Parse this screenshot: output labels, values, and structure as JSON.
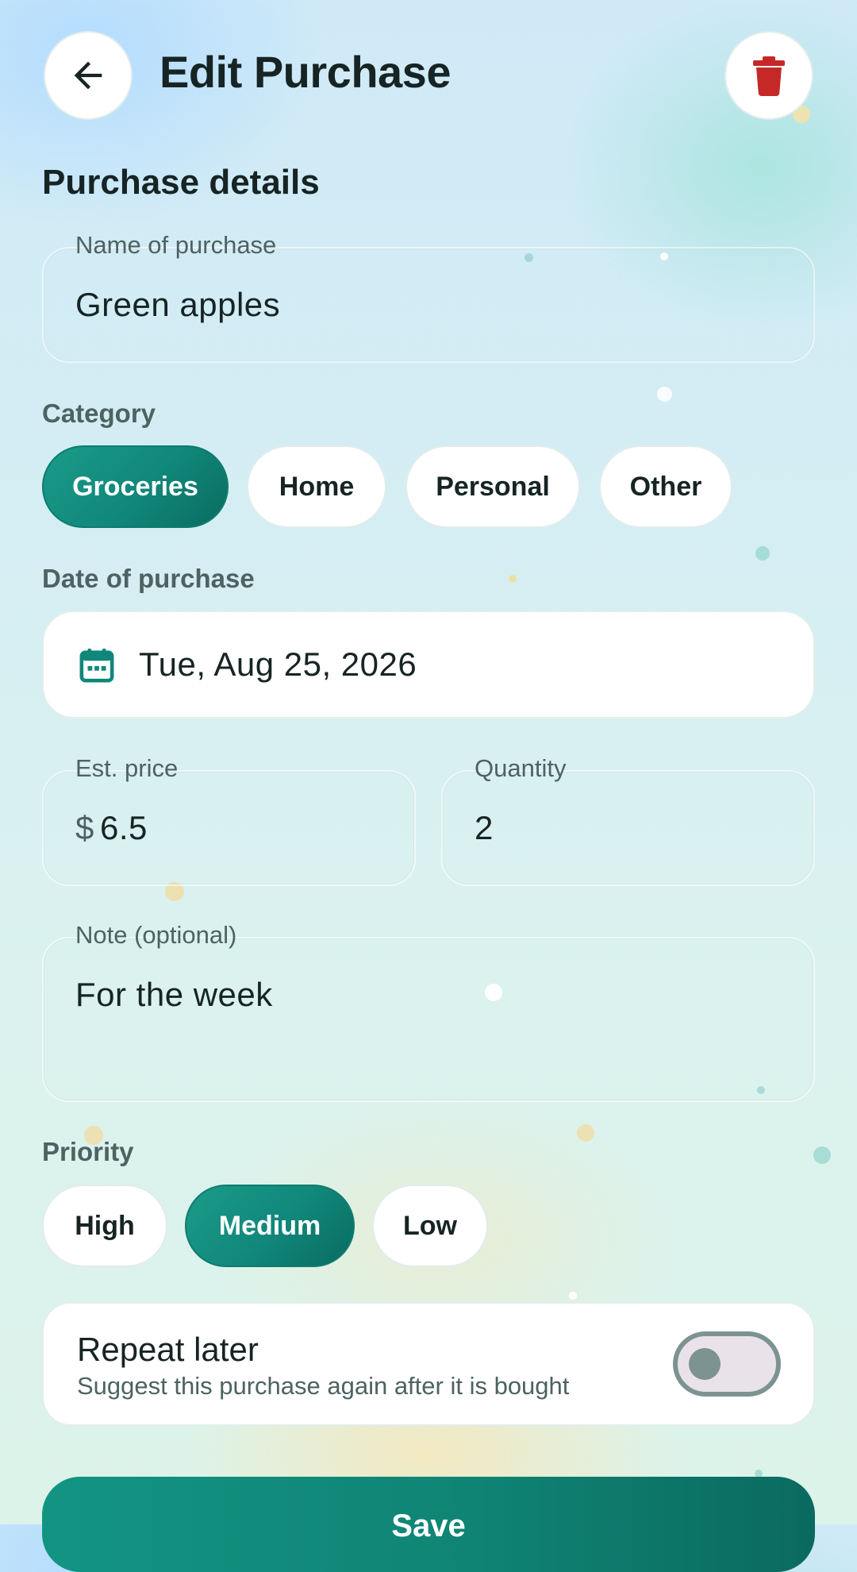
{
  "header": {
    "title": "Edit Purchase",
    "back_icon": "arrow-left-icon",
    "delete_icon": "trash-icon"
  },
  "section": {
    "title": "Purchase details"
  },
  "name_field": {
    "label": "Name of purchase",
    "value": "Green apples"
  },
  "category": {
    "label": "Category",
    "options": [
      "Groceries",
      "Home",
      "Personal",
      "Other"
    ],
    "selected": "Groceries"
  },
  "date": {
    "label": "Date of purchase",
    "value": "Tue, Aug 25, 2026",
    "icon": "calendar-icon"
  },
  "price_field": {
    "label": "Est. price",
    "prefix": "$",
    "value": "6.5"
  },
  "quantity_field": {
    "label": "Quantity",
    "value": "2"
  },
  "note_field": {
    "label": "Note (optional)",
    "value": "For the week"
  },
  "priority": {
    "label": "Priority",
    "options": [
      "High",
      "Medium",
      "Low"
    ],
    "selected": "Medium"
  },
  "repeat": {
    "title": "Repeat later",
    "subtitle": "Suggest this purchase again after it is bought",
    "enabled": false
  },
  "save_button": {
    "label": "Save"
  },
  "colors": {
    "accent": "#10877a",
    "delete": "#c62828",
    "text": "#172424",
    "muted": "#4d6262"
  }
}
